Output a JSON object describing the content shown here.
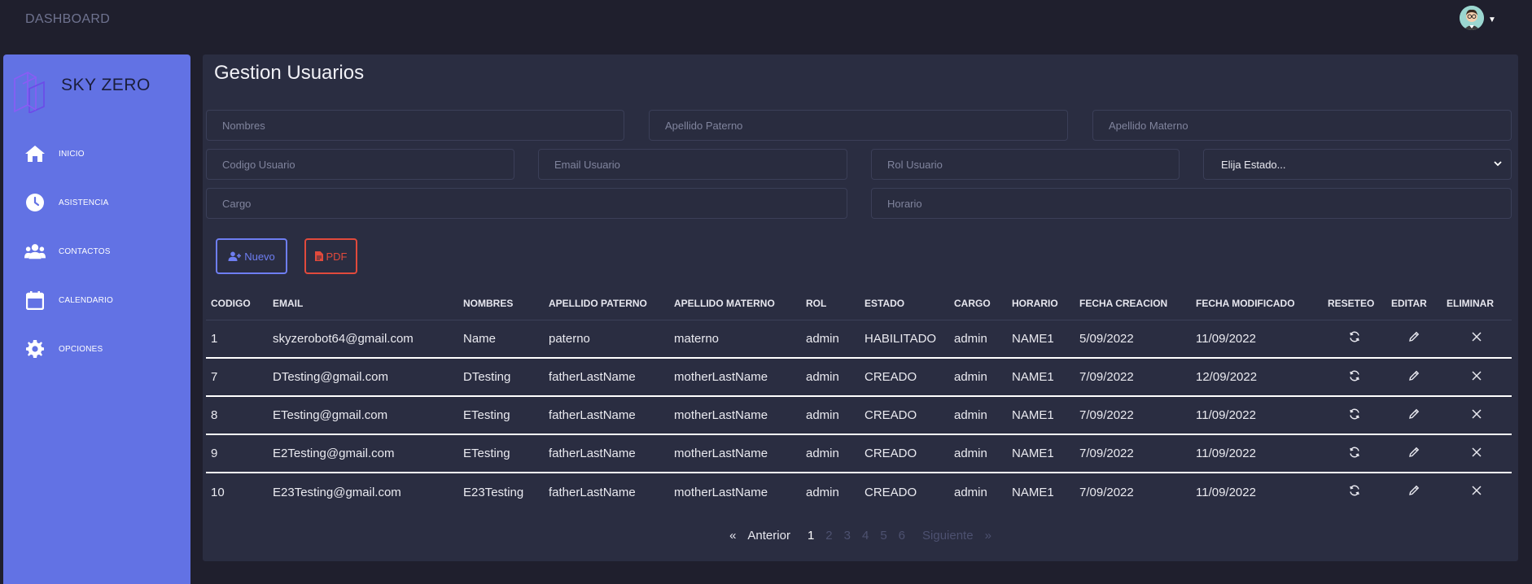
{
  "topbar": {
    "brand": "DASHBOARD",
    "avatar_icon": "user-avatar-icon"
  },
  "sidebar": {
    "logo_text": "SKY ZERO",
    "items": [
      {
        "label": "INICIO",
        "icon": "home-icon"
      },
      {
        "label": "ASISTENCIA",
        "icon": "clock-icon"
      },
      {
        "label": "CONTACTOS",
        "icon": "users-icon"
      },
      {
        "label": "CALENDARIO",
        "icon": "calendar-icon"
      },
      {
        "label": "OPCIONES",
        "icon": "gear-icon"
      }
    ],
    "color": "#6272e4"
  },
  "main": {
    "title": "Gestion Usuarios",
    "filters": {
      "nombres": "Nombres",
      "apellido_paterno": "Apellido Paterno",
      "apellido_materno": "Apellido Materno",
      "codigo_usuario": "Codigo Usuario",
      "email_usuario": "Email Usuario",
      "rol_usuario": "Rol Usuario",
      "estado_select": "Elija Estado...",
      "cargo": "Cargo",
      "horario": "Horario"
    },
    "buttons": {
      "nuevo": "Nuevo",
      "pdf": "PDF"
    },
    "table": {
      "headers": [
        "CODIGO",
        "EMAIL",
        "NOMBRES",
        "APELLIDO PATERNO",
        "APELLIDO MATERNO",
        "ROL",
        "ESTADO",
        "CARGO",
        "HORARIO",
        "FECHA CREACION",
        "FECHA MODIFICADO",
        "RESETEO",
        "EDITAR",
        "ELIMINAR"
      ],
      "rows": [
        [
          "1",
          "skyzerobot64@gmail.com",
          "Name",
          "paterno",
          "materno",
          "admin",
          "HABILITADO",
          "admin",
          "NAME1",
          "5/09/2022",
          "11/09/2022"
        ],
        [
          "7",
          "DTesting@gmail.com",
          "DTesting",
          "fatherLastName",
          "motherLastName",
          "admin",
          "CREADO",
          "admin",
          "NAME1",
          "7/09/2022",
          "12/09/2022"
        ],
        [
          "8",
          "ETesting@gmail.com",
          "ETesting",
          "fatherLastName",
          "motherLastName",
          "admin",
          "CREADO",
          "admin",
          "NAME1",
          "7/09/2022",
          "11/09/2022"
        ],
        [
          "9",
          "E2Testing@gmail.com",
          "ETesting",
          "fatherLastName",
          "motherLastName",
          "admin",
          "CREADO",
          "admin",
          "NAME1",
          "7/09/2022",
          "11/09/2022"
        ],
        [
          "10",
          "E23Testing@gmail.com",
          "E23Testing",
          "fatherLastName",
          "motherLastName",
          "admin",
          "CREADO",
          "admin",
          "NAME1",
          "7/09/2022",
          "11/09/2022"
        ]
      ],
      "action_icons": [
        "refresh-icon",
        "pencil-icon",
        "close-icon"
      ]
    },
    "pagination": {
      "first": "«",
      "prev": "Anterior",
      "pages": [
        "1",
        "2",
        "3",
        "4",
        "5",
        "6"
      ],
      "current": "1",
      "next": "Siguiente",
      "last": "»"
    }
  },
  "colors": {
    "accent": "#6e7ef2",
    "danger": "#e14a3c",
    "panel": "#2a2d41",
    "background": "#1f1f2d"
  }
}
